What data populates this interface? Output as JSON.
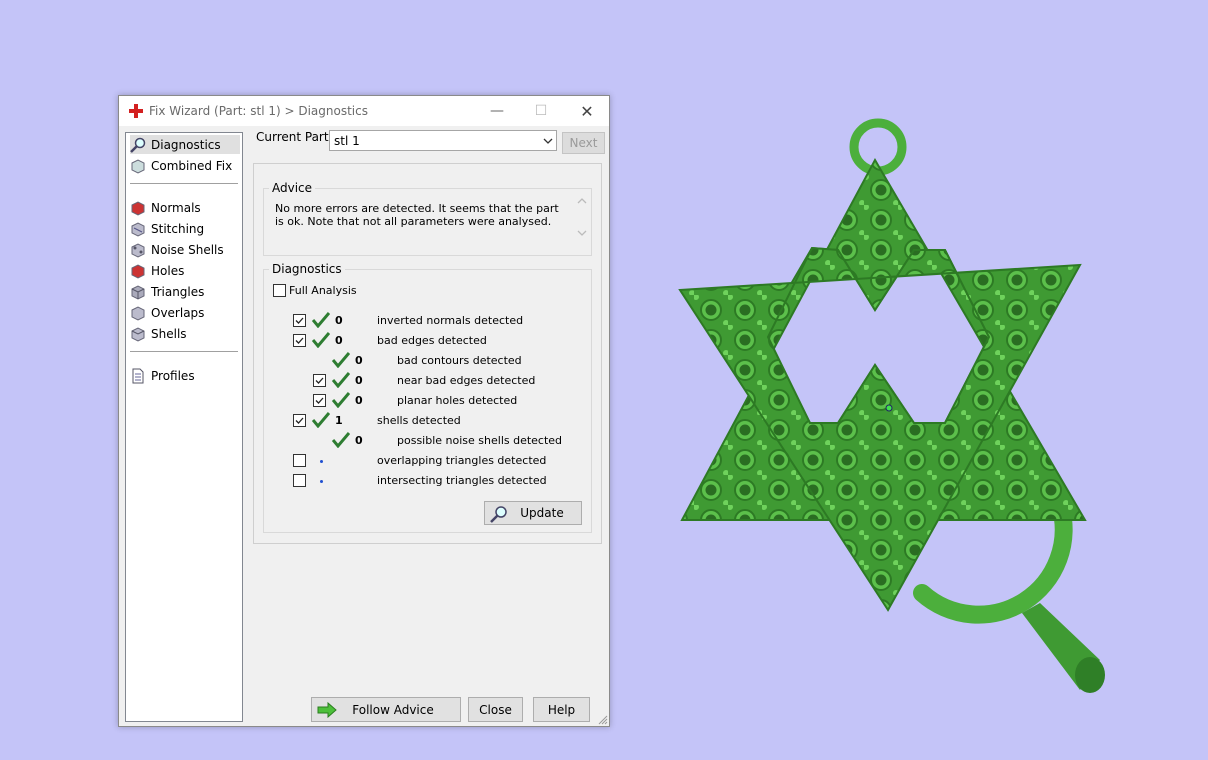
{
  "window": {
    "title": "Fix Wizard (Part: stl 1) > Diagnostics",
    "controls": {
      "minimize": "—",
      "maximize": "☐",
      "close": "✕"
    }
  },
  "nav": {
    "items": [
      {
        "label": "Diagnostics",
        "icon": "magnifier-icon",
        "selected": true
      },
      {
        "label": "Combined Fix",
        "icon": "cube-icon"
      },
      {
        "label": "Normals",
        "icon": "normals-cube-icon"
      },
      {
        "label": "Stitching",
        "icon": "stitching-cube-icon"
      },
      {
        "label": "Noise Shells",
        "icon": "noise-shells-icon"
      },
      {
        "label": "Holes",
        "icon": "holes-cube-icon"
      },
      {
        "label": "Triangles",
        "icon": "triangles-cube-icon"
      },
      {
        "label": "Overlaps",
        "icon": "overlaps-cube-icon"
      },
      {
        "label": "Shells",
        "icon": "shells-cube-icon"
      },
      {
        "label": "Profiles",
        "icon": "document-icon"
      }
    ]
  },
  "part": {
    "label": "Current Part:",
    "value": "stl 1",
    "next_label": "Next"
  },
  "advice": {
    "title": "Advice",
    "text": "No more errors are detected. It seems that the part is ok. Note that not all parameters were analysed."
  },
  "diagnostics": {
    "title": "Diagnostics",
    "full_analysis_label": "Full Analysis",
    "full_analysis_checked": false,
    "rows": [
      {
        "checkbox": true,
        "checked": true,
        "status": "ok",
        "count": "0",
        "label": "inverted normals detected"
      },
      {
        "checkbox": true,
        "checked": true,
        "status": "ok",
        "count": "0",
        "label": "bad edges detected"
      },
      {
        "checkbox": false,
        "status": "ok",
        "count": "0",
        "label": "bad contours detected"
      },
      {
        "checkbox": true,
        "checked": true,
        "status": "ok",
        "count": "0",
        "label": "near bad edges detected"
      },
      {
        "checkbox": true,
        "checked": true,
        "status": "ok",
        "count": "0",
        "label": "planar holes detected"
      },
      {
        "checkbox": true,
        "checked": true,
        "status": "ok",
        "count": "1",
        "label": "shells detected"
      },
      {
        "checkbox": false,
        "status": "ok",
        "count": "0",
        "label": "possible noise shells detected"
      },
      {
        "checkbox": true,
        "checked": false,
        "status": "pending",
        "count": "",
        "label": "overlapping triangles detected"
      },
      {
        "checkbox": true,
        "checked": false,
        "status": "pending",
        "count": "",
        "label": "intersecting triangles detected"
      }
    ],
    "update_label": "Update"
  },
  "footer": {
    "follow_advice": "Follow Advice",
    "close": "Close",
    "help": "Help"
  },
  "colors": {
    "background": "#c4c4f8",
    "model_green": "#4caf3c",
    "check_green": "#2e7d32"
  }
}
